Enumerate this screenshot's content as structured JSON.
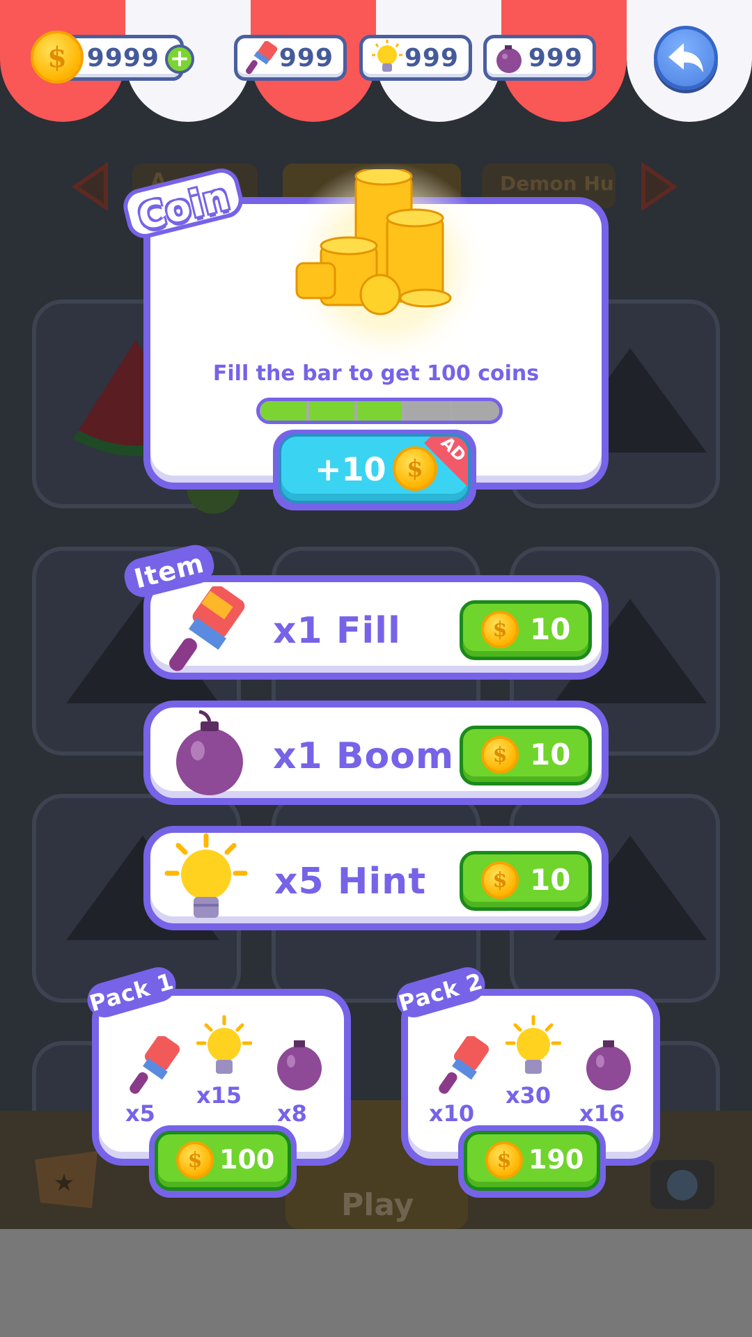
{
  "currency": {
    "coins": "9999",
    "fill": "999",
    "hint": "999",
    "boom": "999",
    "coin_symbol": "$",
    "add_symbol": "+"
  },
  "background": {
    "tab_right": "Demon Hun",
    "tab_left": "A",
    "play_label": "Play"
  },
  "coin_offer": {
    "title": "Coin",
    "caption": "Fill the bar to get 100 coins",
    "progress": {
      "filled": 3,
      "total": 5
    },
    "ad_button_label": "+10",
    "ad_badge": "AD"
  },
  "items": {
    "ribbon": "Item",
    "list": [
      {
        "label": "x1 Fill",
        "icon": "paint-brush-icon",
        "price": "10"
      },
      {
        "label": "x1 Boom",
        "icon": "bomb-icon",
        "price": "10"
      },
      {
        "label": "x5 Hint",
        "icon": "lightbulb-icon",
        "price": "10"
      }
    ]
  },
  "packs": [
    {
      "ribbon": "Pack 1",
      "fill": "x5",
      "hint": "x15",
      "boom": "x8",
      "price": "100"
    },
    {
      "ribbon": "Pack 2",
      "fill": "x10",
      "hint": "x30",
      "boom": "x16",
      "price": "190"
    }
  ],
  "colors": {
    "accent": "#7663e8",
    "green": "#6fd42c",
    "cyan": "#3bd3f2",
    "awning_red": "#fa5757"
  }
}
